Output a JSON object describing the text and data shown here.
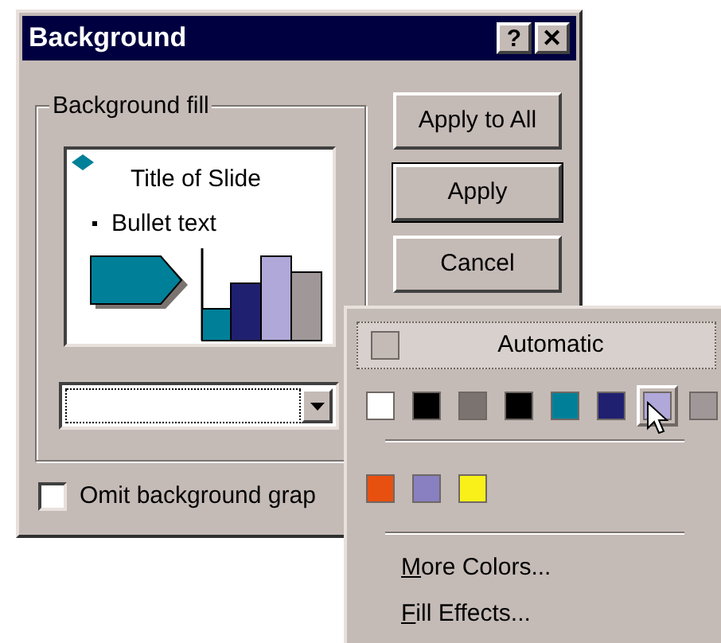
{
  "window": {
    "title": "Background",
    "title_buttons": [
      "?",
      "✕"
    ]
  },
  "group": {
    "label": "Background fill",
    "preview": {
      "title": "Title of Slide",
      "bullet": "Bullet text"
    }
  },
  "buttons": [
    "Apply to All",
    "Apply",
    "Cancel"
  ],
  "checkbox": {
    "label": "Omit background grap",
    "checked": false
  },
  "popup": {
    "automatic": "Automatic",
    "swatches": [
      {
        "color": "#ffffff",
        "selected": false
      },
      {
        "color": "#000000",
        "selected": false
      },
      {
        "color": "#7a7370",
        "selected": false
      },
      {
        "color": "#000000",
        "selected": false
      },
      {
        "color": "#008098",
        "selected": false
      },
      {
        "color": "#202070",
        "selected": false
      },
      {
        "color": "#b0a8d8",
        "selected": true
      },
      {
        "color": "#a09898",
        "selected": false
      }
    ],
    "extra_swatches": [
      {
        "color": "#e85010",
        "selected": false
      },
      {
        "color": "#8880c0",
        "selected": false
      },
      {
        "color": "#f8f018",
        "selected": false
      }
    ],
    "items": [
      {
        "label": "More Colors...",
        "first_letter_underlined": true
      },
      {
        "label": "Fill Effects...",
        "first_letter_underlined": true
      }
    ]
  }
}
